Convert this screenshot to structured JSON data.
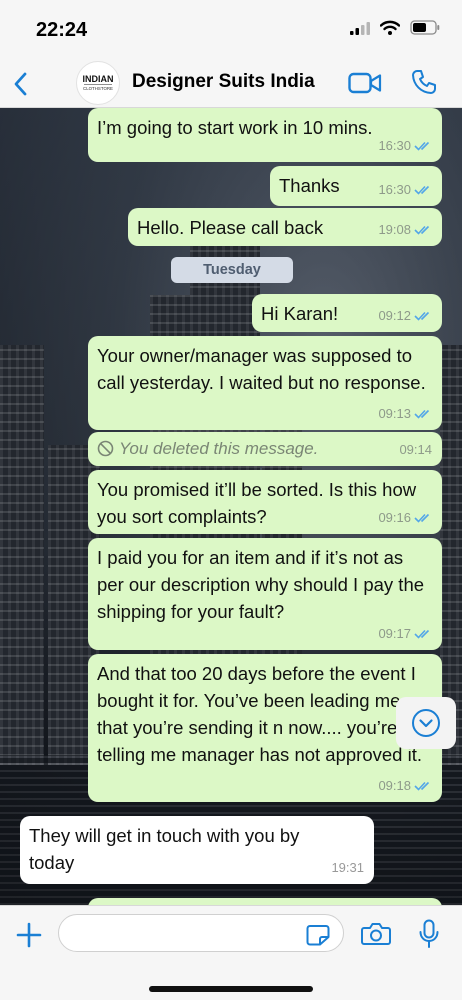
{
  "status_bar": {
    "time": "22:24",
    "icons": [
      "signal-icon",
      "wifi-icon",
      "battery-icon"
    ]
  },
  "header": {
    "back_icon": "chevron-left-icon",
    "avatar_logo": "INDIAN CLOTHSTORE",
    "title": "Designer Suits India",
    "video_icon": "video-camera-icon",
    "phone_icon": "phone-icon"
  },
  "colors": {
    "accent": "#1a7fd4",
    "outgoing_bubble": "#dcf8c6",
    "incoming_bubble": "#ffffff",
    "read_ticks": "#53a6e8"
  },
  "date_separator": "Tuesday",
  "messages": [
    {
      "direction": "out",
      "text": "I’m going to start work in 10 mins.",
      "time": "16:30",
      "status": "read"
    },
    {
      "direction": "out",
      "text": "Thanks",
      "time": "16:30",
      "status": "read"
    },
    {
      "direction": "out",
      "text": "Hello. Please call back",
      "time": "19:08",
      "status": "read"
    },
    {
      "direction": "out",
      "text": "Hi Karan!",
      "time": "09:12",
      "status": "read"
    },
    {
      "direction": "out",
      "text": "Your owner/manager was supposed to call yesterday. I waited but no response.",
      "time": "09:13",
      "status": "read"
    },
    {
      "direction": "out",
      "text": "You deleted this message.",
      "time": "09:14",
      "deleted": true
    },
    {
      "direction": "out",
      "text": "You promised it’ll be sorted. Is this how you sort complaints?",
      "time": "09:16",
      "status": "read"
    },
    {
      "direction": "out",
      "text": "I paid you for  an item and if it’s not as per our description why should I pay the shipping for your fault?",
      "time": "09:17",
      "status": "read"
    },
    {
      "direction": "out",
      "text": "And that too 20 days before the event I bought it for. You’ve been leading me on that you’re sending it n now.... you’re telling me manager has not approved it.",
      "time": "09:18",
      "status": "read"
    },
    {
      "direction": "in",
      "text": "They will get in touch with you by today",
      "time": "19:31"
    }
  ],
  "input_bar": {
    "message_value": "",
    "icons": [
      "plus-icon",
      "sticker-icon",
      "camera-icon",
      "microphone-icon"
    ]
  },
  "scroll_button_icon": "chevron-down-icon"
}
